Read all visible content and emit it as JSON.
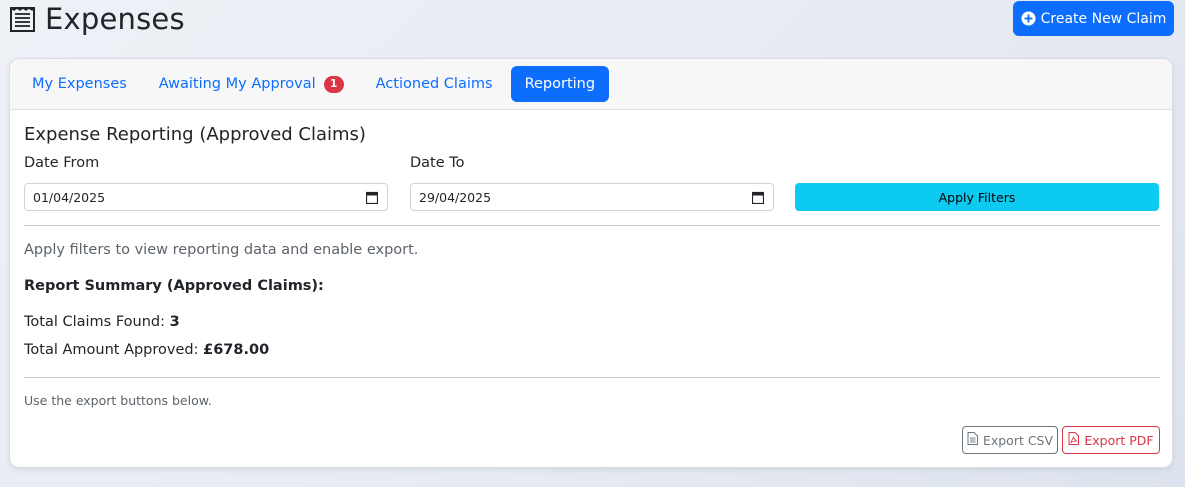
{
  "header": {
    "title": "Expenses",
    "icon": "receipt-icon",
    "create_button_label": "Create New Claim",
    "create_button_icon": "plus-circle-icon"
  },
  "tabs": [
    {
      "label": "My Expenses",
      "active": false
    },
    {
      "label": "Awaiting My Approval",
      "badge": "1",
      "active": false
    },
    {
      "label": "Actioned Claims",
      "active": false
    },
    {
      "label": "Reporting",
      "active": true
    }
  ],
  "reporting": {
    "title": "Expense Reporting (Approved Claims)",
    "date_from_label": "Date From",
    "date_from_value": "01/04/2025",
    "date_to_label": "Date To",
    "date_to_value": "29/04/2025",
    "apply_button_label": "Apply Filters",
    "hint": "Apply filters to view reporting data and enable export.",
    "summary_title": "Report Summary (Approved Claims):",
    "total_claims_label": "Total Claims Found: ",
    "total_claims_value": "3",
    "total_amount_label": "Total Amount Approved: ",
    "total_amount_value": "£678.00",
    "export_note": "Use the export buttons below.",
    "export_csv_label": "Export CSV",
    "export_pdf_label": "Export PDF"
  },
  "colors": {
    "primary": "#0d6efd",
    "info": "#0dcaf0",
    "danger": "#dc3545",
    "secondary": "#6c757d"
  }
}
